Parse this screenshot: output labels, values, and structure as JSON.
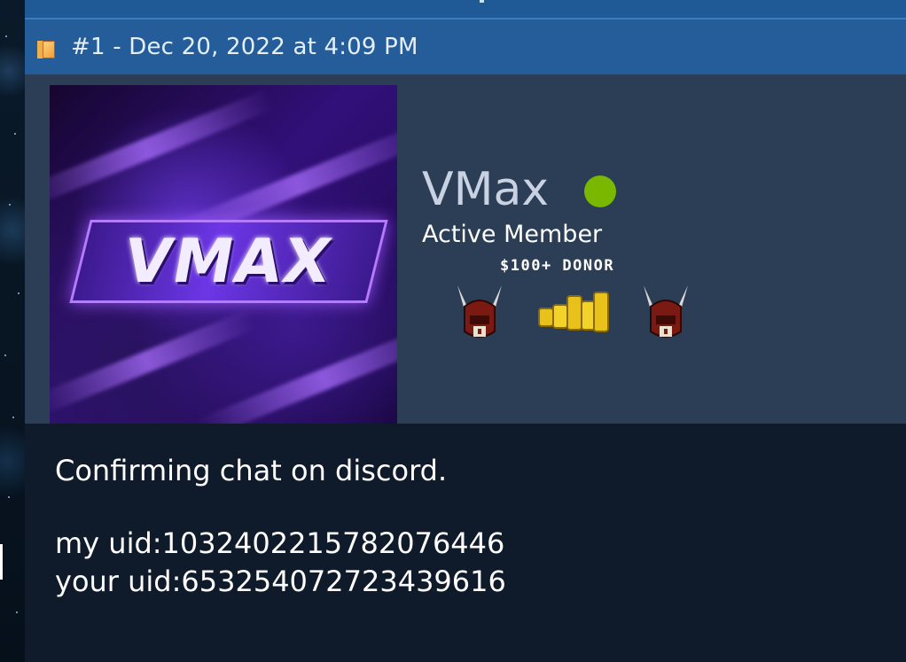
{
  "post": {
    "meta": "#1 - Dec 20, 2022 at 4:09 PM",
    "icon": "post-icon"
  },
  "user": {
    "name": "VMax",
    "title": "Active Member",
    "online": true,
    "online_color": "#7ab800",
    "avatar_text": "VMAX",
    "donor_label": "$100+ DONOR",
    "badges": [
      "helmet-icon",
      "gold-coins-icon",
      "helmet-icon"
    ]
  },
  "body": {
    "line1": "Confirming chat on discord.",
    "line2": "my uid:1032402215782076446",
    "line3": "your uid:653254072723439616"
  },
  "colors": {
    "header": "#245d99",
    "panel": "#2b3e55",
    "body": "#0f1b2b"
  }
}
